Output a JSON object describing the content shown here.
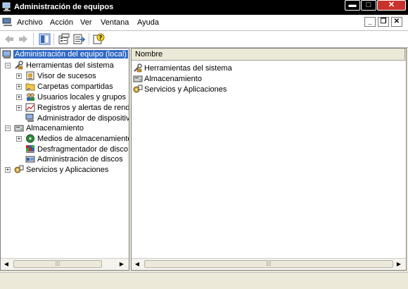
{
  "window": {
    "title": "Administración de equipos"
  },
  "menu": {
    "items": [
      "Archivo",
      "Acción",
      "Ver",
      "Ventana",
      "Ayuda"
    ]
  },
  "tree": {
    "root": "Administración del equipo (local)",
    "nodes": [
      {
        "label": "Herramientas del sistema",
        "icon": "tools-icon"
      },
      {
        "label": "Visor de sucesos",
        "icon": "event-viewer-icon"
      },
      {
        "label": "Carpetas compartidas",
        "icon": "shared-folder-icon"
      },
      {
        "label": "Usuarios locales y grupos",
        "icon": "users-icon"
      },
      {
        "label": "Registros y alertas de rendim",
        "icon": "performance-icon"
      },
      {
        "label": "Administrador de dispositivos",
        "icon": "device-manager-icon"
      },
      {
        "label": "Almacenamiento",
        "icon": "storage-icon"
      },
      {
        "label": "Medios de almacenamiento e",
        "icon": "removable-storage-icon"
      },
      {
        "label": "Desfragmentador de disco",
        "icon": "defrag-icon"
      },
      {
        "label": "Administración de discos",
        "icon": "disk-management-icon"
      },
      {
        "label": "Servicios y Aplicaciones",
        "icon": "services-icon"
      }
    ]
  },
  "list": {
    "column": "Nombre",
    "rows": [
      "Herramientas del sistema",
      "Almacenamiento",
      "Servicios y Aplicaciones"
    ]
  },
  "colors": {
    "titlebar": "#000000",
    "selection": "#316ac5",
    "close_button": "#c8312c",
    "window_face": "#ece9d8"
  }
}
